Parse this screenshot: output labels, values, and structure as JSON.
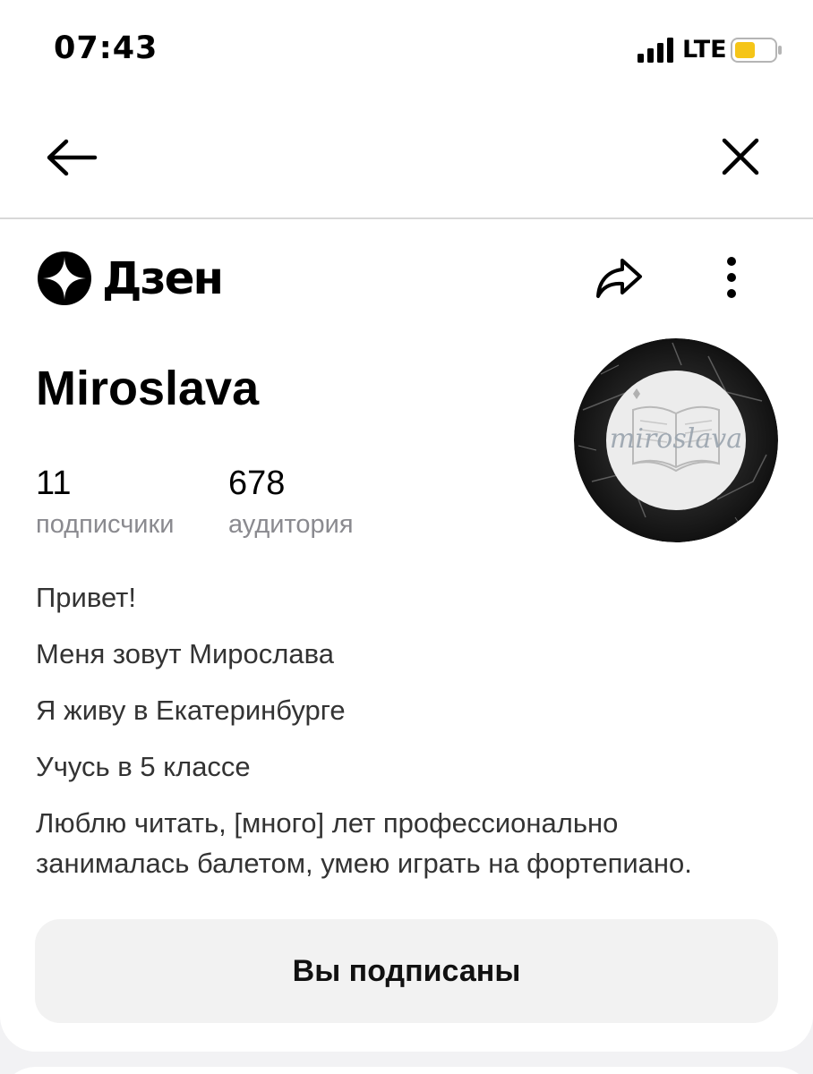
{
  "status_bar": {
    "time": "07:43",
    "network": "LTE",
    "battery_color": "#f5c518"
  },
  "nav": {
    "back_icon": "arrow-left-icon",
    "close_icon": "close-icon"
  },
  "header": {
    "logo_text": "Дзен",
    "share_icon": "share-icon",
    "more_icon": "more-vertical-icon"
  },
  "profile": {
    "name": "Miroslava",
    "subscribers_value": "11",
    "subscribers_label": "подписчики",
    "audience_value": "678",
    "audience_label": "аудитория",
    "avatar_text": "miroslava"
  },
  "bio": {
    "lines": [
      "Привет!",
      "Меня зовут Мирослава",
      "Я живу в Екатеринбурге",
      "Учусь в 5 классе",
      "Люблю читать, [много] лет профессионально занималась балетом, умею играть на фортепиано."
    ]
  },
  "subscribe_button": {
    "label": "Вы подписаны"
  }
}
